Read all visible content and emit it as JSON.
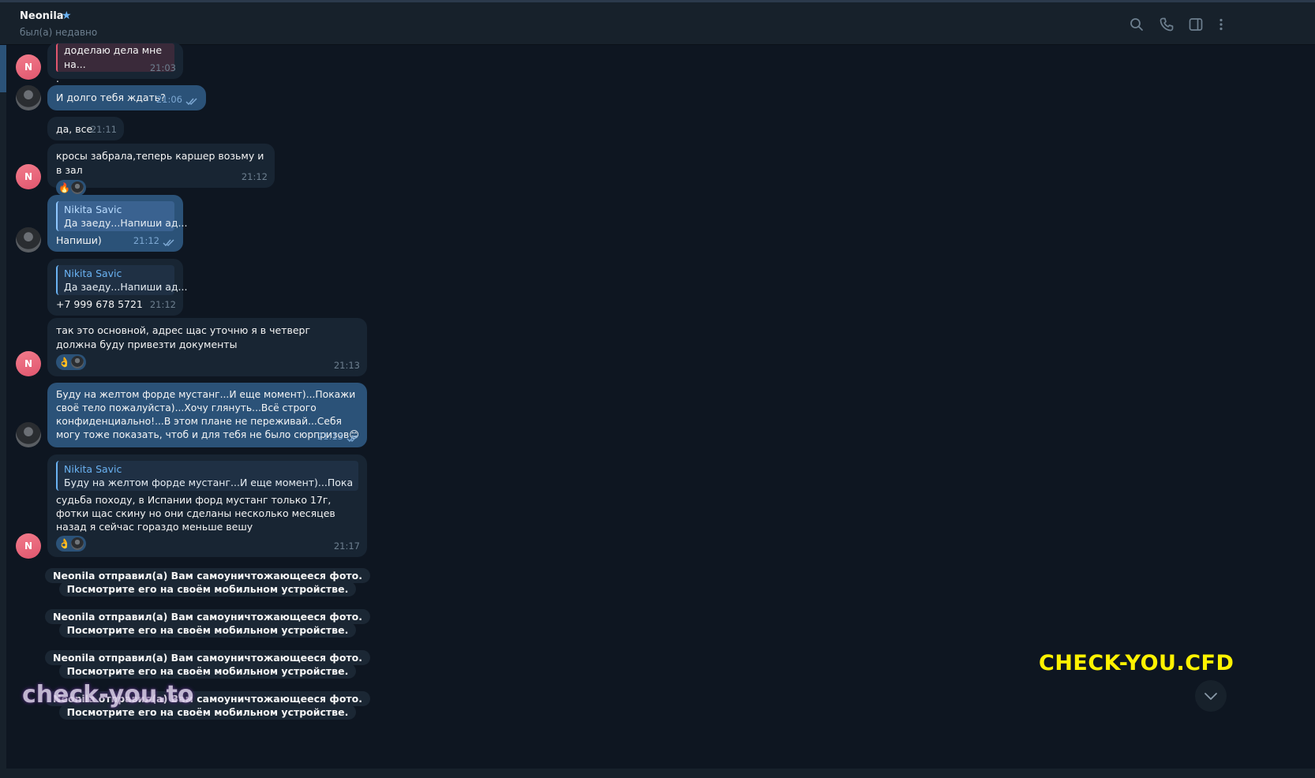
{
  "header": {
    "name": "Neonila",
    "status": "был(а) недавно",
    "icons": [
      "search-icon",
      "phone-icon",
      "sidebar-toggle-icon",
      "more-vertical-icon"
    ]
  },
  "avatar_initial": "N",
  "sender_name": "Nikita Savic",
  "messages": {
    "m1": {
      "quote": "доделаю дела мне на...",
      "text": ".",
      "time": "21:03"
    },
    "m2": {
      "text": "И долго тебя ждать?",
      "time": "21:06"
    },
    "m3": {
      "text": "да, все",
      "time": "21:11"
    },
    "m4": {
      "text": "кросы забрала,теперь каршер возьму и в зал",
      "time": "21:12",
      "reaction": "🔥"
    },
    "m5": {
      "reply_text": "Да заеду...Напиши ад...",
      "text": "Напиши)",
      "time": "21:12"
    },
    "m6": {
      "reply_text": "Да заеду...Напиши ад...",
      "text": "+7 999 678 5721",
      "time": "21:12"
    },
    "m7": {
      "text": "так это основной, адрес щас уточню я в четверг должна буду привезти документы",
      "time": "21:13",
      "reaction": "👌"
    },
    "m8": {
      "text": "Буду на желтом форде мустанг...И еще момент)...Покажи своё тело пожалуйста)...Хочу глянуть...Всё строго конфиденциально!...В этом плане не переживай...Себя могу тоже показать, чтоб и для тебя не было сюрпризов😊",
      "time": "21:13"
    },
    "m9": {
      "reply_text": "Буду на желтом форде мустанг...И еще момент)...Покажи сво...",
      "text": "судьба походу, в Испании форд мустанг только 17г, фотки щас скину но они сделаны несколько месяцев назад я сейчас гораздо меньше вешу",
      "time": "21:17",
      "reaction": "👌"
    }
  },
  "service_message": "Neonila отправил(а) Вам самоуничтожающееся фото. Посмотрите его на своём мобильном устройстве.",
  "watermarks": {
    "right": "CHECK-YOU.CFD",
    "left": "check-you.to"
  },
  "colors": {
    "background": "#0e1621",
    "incoming_bubble": "#182533",
    "outgoing_bubble": "#2b5278",
    "accent": "#6ab2f2",
    "watermark_yellow": "#fff200"
  }
}
